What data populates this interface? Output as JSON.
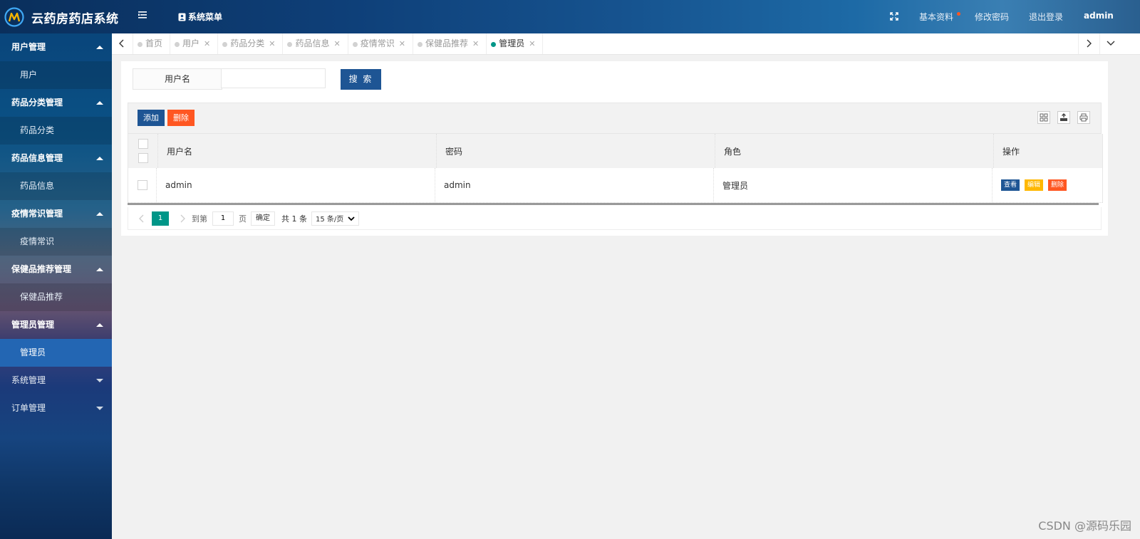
{
  "header": {
    "title": "云药房药店系统",
    "system_menu": "系统菜单",
    "profile": "基本资料",
    "change_password": "修改密码",
    "logout": "退出登录",
    "user": "admin"
  },
  "sidebar": {
    "groups": [
      {
        "label": "用户管理",
        "expanded": true,
        "items": [
          "用户"
        ]
      },
      {
        "label": "药品分类管理",
        "expanded": true,
        "items": [
          "药品分类"
        ]
      },
      {
        "label": "药品信息管理",
        "expanded": true,
        "items": [
          "药品信息"
        ]
      },
      {
        "label": "疫情常识管理",
        "expanded": true,
        "items": [
          "疫情常识"
        ]
      },
      {
        "label": "保健品推荐管理",
        "expanded": true,
        "items": [
          "保健品推荐"
        ]
      },
      {
        "label": "管理员管理",
        "expanded": true,
        "items": [
          "管理员"
        ]
      },
      {
        "label": "系统管理",
        "expanded": false,
        "items": []
      },
      {
        "label": "订单管理",
        "expanded": false,
        "items": []
      }
    ],
    "active_item": "管理员"
  },
  "tabs": [
    {
      "label": "首页",
      "closable": false
    },
    {
      "label": "用户",
      "closable": true
    },
    {
      "label": "药品分类",
      "closable": true
    },
    {
      "label": "药品信息",
      "closable": true
    },
    {
      "label": "疫情常识",
      "closable": true
    },
    {
      "label": "保健品推荐",
      "closable": true
    },
    {
      "label": "管理员",
      "closable": true,
      "active": true
    }
  ],
  "search": {
    "label": "用户名",
    "value": "",
    "button": "搜 索"
  },
  "toolbar": {
    "add": "添加",
    "delete": "删除"
  },
  "table": {
    "columns": [
      "用户名",
      "密码",
      "角色",
      "操作"
    ],
    "rows": [
      {
        "username": "admin",
        "password": "admin",
        "role": "管理员"
      }
    ],
    "actions": {
      "view": "查看",
      "edit": "编辑",
      "delete": "删除"
    }
  },
  "pagination": {
    "current": "1",
    "goto_label": "到第",
    "page_input": "1",
    "page_unit": "页",
    "confirm": "确定",
    "total": "共 1 条",
    "page_size": "15 条/页"
  },
  "watermark": "CSDN @源码乐园",
  "colors": {
    "primary": "#1e5594",
    "danger": "#ff5722",
    "warning": "#ffb800",
    "teal": "#009688"
  }
}
